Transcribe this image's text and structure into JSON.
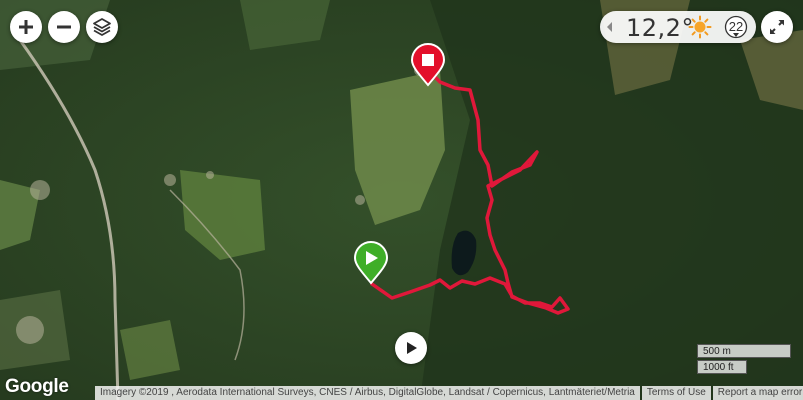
{
  "map": {
    "view": "satellite",
    "colors": {
      "track": "#e0183a",
      "start": "#3fae28",
      "end": "#e3102b"
    }
  },
  "controls": {
    "zoom_in": "plus-icon",
    "zoom_out": "minus-icon",
    "layers": "layers-icon",
    "fullscreen": "expand-icon"
  },
  "weather": {
    "temperature": "12,2°",
    "condition_icon": "sun-icon",
    "wind_speed": "22"
  },
  "playback": {
    "icon": "play-icon"
  },
  "scale": {
    "metric": "500 m",
    "imperial": "1000 ft"
  },
  "footer": {
    "logo": "Google",
    "attribution": "Imagery ©2019 , Aerodata International Surveys, CNES / Airbus, DigitalGlobe, Landsat / Copernicus, Lantmäteriet/Metria",
    "terms": "Terms of Use",
    "report": "Report a map error"
  }
}
